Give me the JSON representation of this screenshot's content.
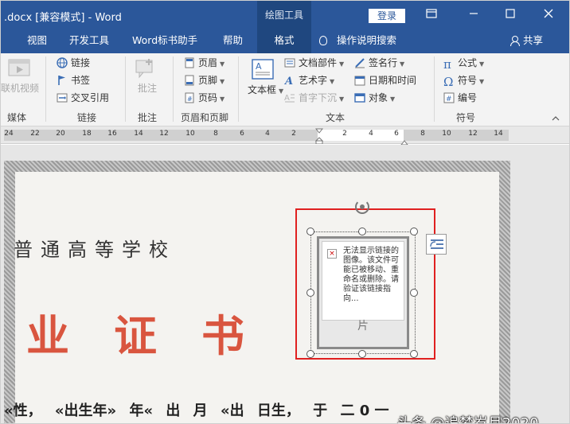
{
  "titlebar": {
    "title": ".docx [兼容模式]  -  Word",
    "context_title": "绘图工具",
    "login": "登录"
  },
  "tabs": {
    "items": [
      "视图",
      "开发工具",
      "Word标书助手",
      "帮助",
      "格式"
    ],
    "search": "操作说明搜索",
    "share": "共享"
  },
  "ribbon": {
    "media": {
      "online_video": "联机视频",
      "label": "媒体"
    },
    "links": {
      "link": "链接",
      "bookmark": "书签",
      "cross_ref": "交叉引用",
      "label": "链接"
    },
    "comments": {
      "comment": "批注",
      "label": "批注"
    },
    "header_footer": {
      "header": "页眉",
      "footer": "页脚",
      "page_number": "页码",
      "label": "页眉和页脚"
    },
    "text": {
      "textbox": "文本框",
      "quick_parts": "文档部件",
      "wordart": "艺术字",
      "dropcap": "首字下沉",
      "signature": "签名行",
      "datetime": "日期和时间",
      "object": "对象",
      "label": "文本"
    },
    "symbols": {
      "equation": "公式",
      "symbol": "符号",
      "number": "编号",
      "label": "符号"
    }
  },
  "ruler": {
    "ticks": [
      "24",
      "22",
      "20",
      "18",
      "16",
      "14",
      "12",
      "10",
      "8",
      "6",
      "4",
      "2",
      "2",
      "4",
      "6",
      "8",
      "10",
      "12",
      "14"
    ]
  },
  "document": {
    "school": "普通高等学校",
    "cert_title": "业证书",
    "bottom_parts": [
      "«性，",
      "«出生年»",
      "年«",
      "出",
      "月",
      "«出",
      "日生，",
      "于",
      "二 0 一"
    ],
    "broken_image_text": "无法显示链接的图像。该文件可能已被移动、重命名或删除。请验证该链接指向...",
    "broken_image_char": "片",
    "watermark": "头条 @追梦岁月2020"
  }
}
